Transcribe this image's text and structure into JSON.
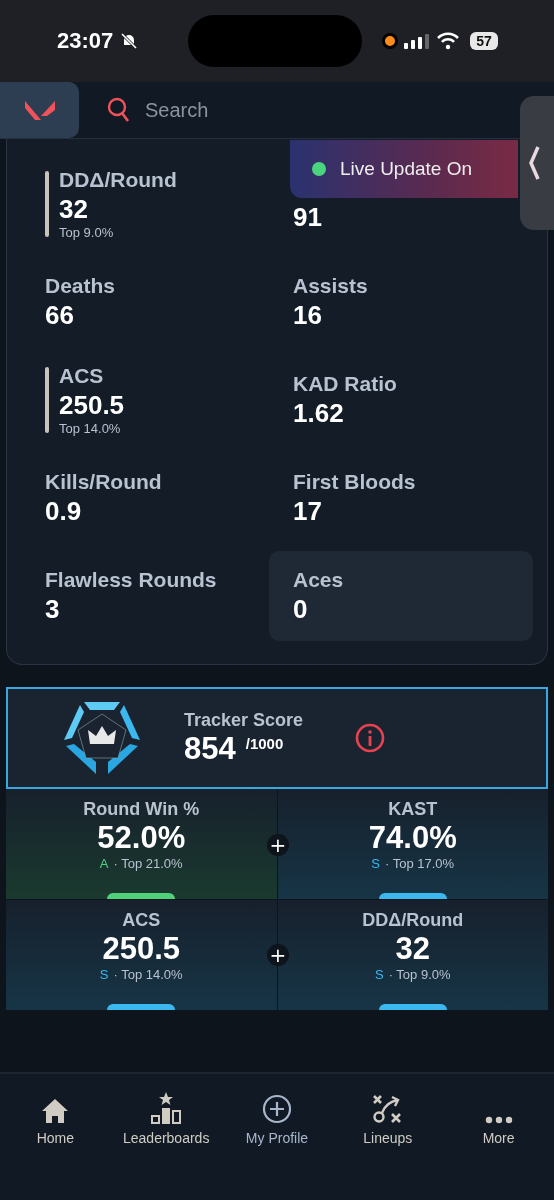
{
  "status_bar": {
    "time": "23:07",
    "battery": "57"
  },
  "header": {
    "search_placeholder": "Search"
  },
  "live_banner": {
    "text": "Live Update On",
    "on": true
  },
  "stats": [
    {
      "label": "DDΔ/Round",
      "value": "32",
      "top": "Top 9.0%",
      "highlighted": false
    },
    {
      "value": "91",
      "highlighted": false
    },
    {
      "label": "Deaths",
      "value": "66",
      "highlighted": false
    },
    {
      "label": "Assists",
      "value": "16",
      "highlighted": false
    },
    {
      "label": "ACS",
      "value": "250.5",
      "top": "Top 14.0%",
      "highlighted": false
    },
    {
      "label": "KAD Ratio",
      "value": "1.62",
      "highlighted": false
    },
    {
      "label": "Kills/Round",
      "value": "0.9",
      "highlighted": false
    },
    {
      "label": "First Bloods",
      "value": "17",
      "highlighted": false
    },
    {
      "label": "Flawless Rounds",
      "value": "3",
      "highlighted": false
    },
    {
      "label": "Aces",
      "value": "0",
      "highlighted": true
    }
  ],
  "tracker_score": {
    "label": "Tracker Score",
    "value": "854",
    "max": "/1000"
  },
  "grades": [
    {
      "label": "Round Win %",
      "value": "52.0%",
      "grade": "A",
      "top": "· Top 21.0%",
      "color": "#4fd17a"
    },
    {
      "label": "KAST",
      "value": "74.0%",
      "grade": "S",
      "top": "· Top 17.0%",
      "color": "#3bb8ef"
    },
    {
      "label": "ACS",
      "value": "250.5",
      "grade": "S",
      "top": "· Top 14.0%",
      "color": "#3bb8ef"
    },
    {
      "label": "DDΔ/Round",
      "value": "32",
      "grade": "S",
      "top": "· Top 9.0%",
      "color": "#3bb8ef"
    }
  ],
  "plus_signs": [
    "+",
    "+"
  ],
  "nav": [
    {
      "label": "Home",
      "selected": false
    },
    {
      "label": "Leaderboards",
      "selected": false
    },
    {
      "label": "My Profile",
      "selected": true
    },
    {
      "label": "Lineups",
      "selected": false
    },
    {
      "label": "More",
      "selected": false
    }
  ]
}
